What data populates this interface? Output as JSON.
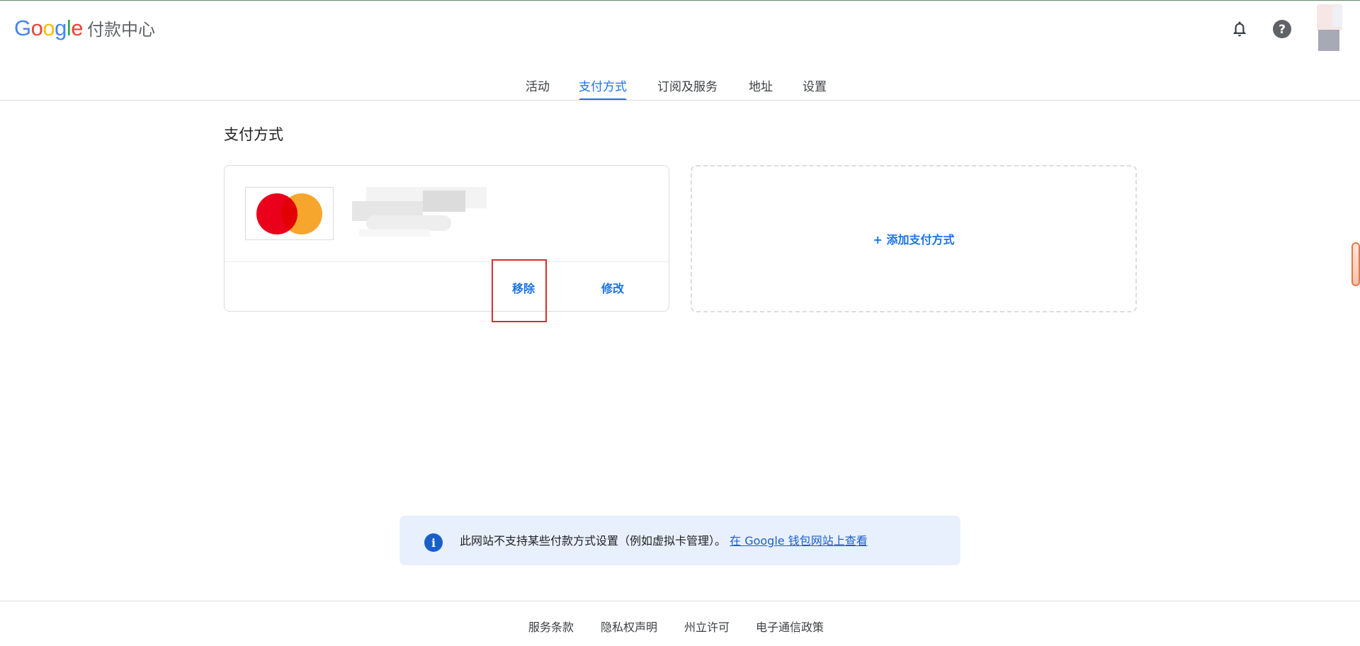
{
  "brand": {
    "google_letters": [
      "G",
      "o",
      "o",
      "g",
      "l",
      "e"
    ],
    "google_colors": [
      "#4285F4",
      "#EA4335",
      "#FBBC05",
      "#4285F4",
      "#34A853",
      "#EA4335"
    ],
    "product": "付款中心"
  },
  "header": {
    "notifications_icon": "bell-icon",
    "help_icon": "help-circle-icon",
    "account_icon": "avatar"
  },
  "tabs": [
    {
      "label": "活动",
      "active": false
    },
    {
      "label": "支付方式",
      "active": true
    },
    {
      "label": "订阅及服务",
      "active": false
    },
    {
      "label": "地址",
      "active": false
    },
    {
      "label": "设置",
      "active": false
    }
  ],
  "main": {
    "title": "支付方式",
    "card": {
      "network": "Mastercard",
      "remove_label": "移除",
      "edit_label": "修改"
    },
    "add_label": "+ 添加支付方式"
  },
  "banner": {
    "icon": "info-icon",
    "icon_glyph": "i",
    "text": "此网站不支持某些付款方式设置（例如虚拟卡管理）。",
    "link": "在 Google 钱包网站上查看"
  },
  "footer": {
    "links": [
      "服务条款",
      "隐私权声明",
      "州立许可",
      "电子通信政策"
    ]
  },
  "colors": {
    "accent": "#1a73e8",
    "highlight": "#d32f2f",
    "mastercard_red": "#eb001b",
    "mastercard_orange": "#f79e1b"
  }
}
